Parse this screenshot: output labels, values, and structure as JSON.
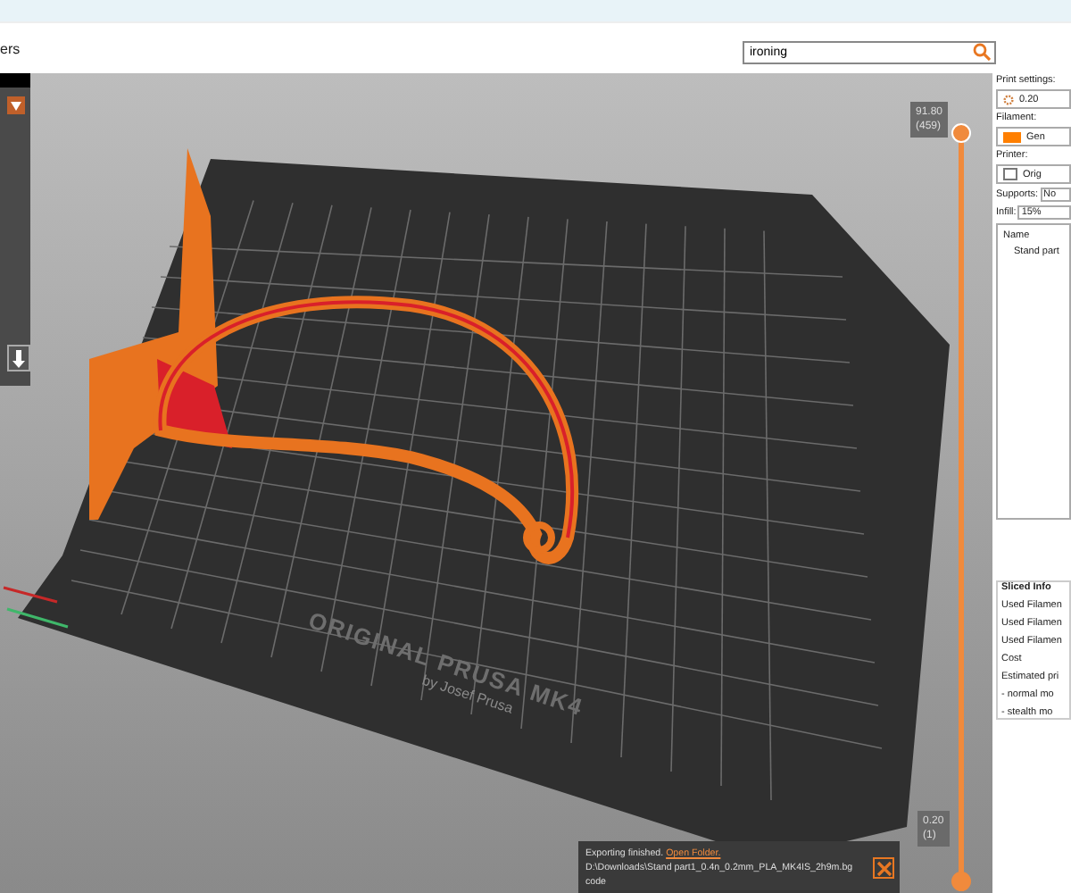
{
  "toolbar": {
    "left_label": "ers",
    "search": {
      "value": "ironing"
    }
  },
  "viewport": {
    "bed_text": [
      "ORIGINAL PRUSA MK4",
      "by Josef Prusa"
    ],
    "layer_slider": {
      "level": 1,
      "top_value": "91.80",
      "top_layer": "(459)",
      "bottom_value": "0.20",
      "bottom_layer": "(1)"
    },
    "notification": {
      "title": "Exporting finished.",
      "link": "Open Folder.",
      "path": "D:\\Downloads\\Stand part1_0.4n_0.2mm_PLA_MK4IS_2h9m.bg",
      "path_end": "code"
    }
  },
  "sidebar": {
    "print_settings_label": "Print settings:",
    "print_settings_value": "0.20",
    "filament_label": "Filament:",
    "filament_value": "Gen",
    "printer_label": "Printer:",
    "printer_value": "Orig",
    "supports_label": "Supports:",
    "supports_value": "No",
    "infill_label": "Infill:",
    "infill_value": "15%",
    "objects": {
      "header": "Name",
      "items": [
        "Stand part"
      ]
    },
    "sliced_info": {
      "title": "Sliced Info",
      "rows": [
        "Used Filamen",
        "Used Filamen",
        "Used Filamen",
        "Cost",
        "Estimated pri",
        "- normal mo",
        "- stealth mo"
      ]
    }
  }
}
